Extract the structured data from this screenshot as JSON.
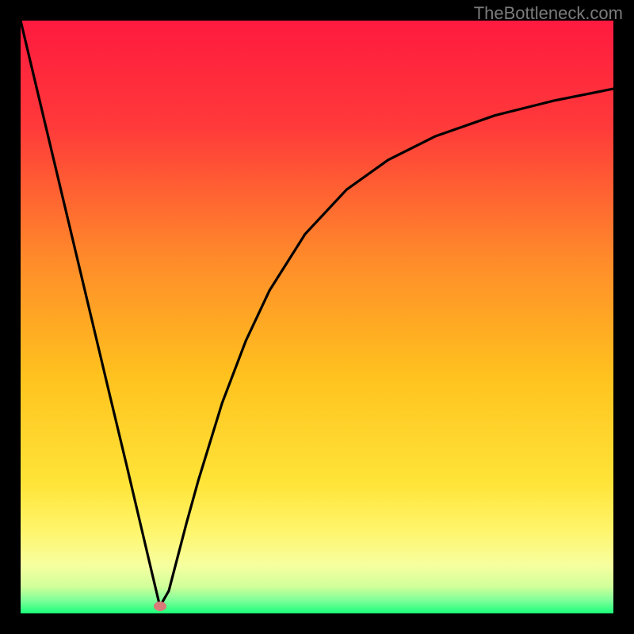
{
  "attribution": "TheBottleneck.com",
  "chart_data": {
    "type": "line",
    "title": "",
    "xlabel": "",
    "ylabel": "",
    "xlim": [
      0,
      100
    ],
    "ylim": [
      0,
      100
    ],
    "grid": false,
    "series": [
      {
        "name": "bottleneck-curve",
        "x": [
          0,
          5,
          10,
          15,
          18,
          20,
          22,
          23.5,
          25,
          28,
          30,
          34,
          38,
          42,
          48,
          55,
          62,
          70,
          80,
          90,
          100
        ],
        "values": [
          100,
          79,
          58,
          37,
          24.5,
          16,
          7.5,
          1.2,
          3.8,
          15.3,
          22.5,
          35.5,
          46,
          54.5,
          64,
          71.5,
          76.5,
          80.5,
          84,
          86.5,
          88.5
        ]
      }
    ],
    "marker": {
      "x": 23.5,
      "y": 1.2,
      "color": "#d97a7a"
    },
    "background_gradient": {
      "stops": [
        {
          "offset": 0.0,
          "color": "#ff1a3f"
        },
        {
          "offset": 0.18,
          "color": "#ff3a3a"
        },
        {
          "offset": 0.4,
          "color": "#ff8a2a"
        },
        {
          "offset": 0.6,
          "color": "#ffc21e"
        },
        {
          "offset": 0.78,
          "color": "#ffe438"
        },
        {
          "offset": 0.86,
          "color": "#fff56b"
        },
        {
          "offset": 0.92,
          "color": "#f6ffa0"
        },
        {
          "offset": 0.955,
          "color": "#d0ff9a"
        },
        {
          "offset": 0.978,
          "color": "#7fff9a"
        },
        {
          "offset": 1.0,
          "color": "#1aff7a"
        }
      ]
    },
    "curve_stroke": "#000000",
    "curve_stroke_width": 3.2
  }
}
